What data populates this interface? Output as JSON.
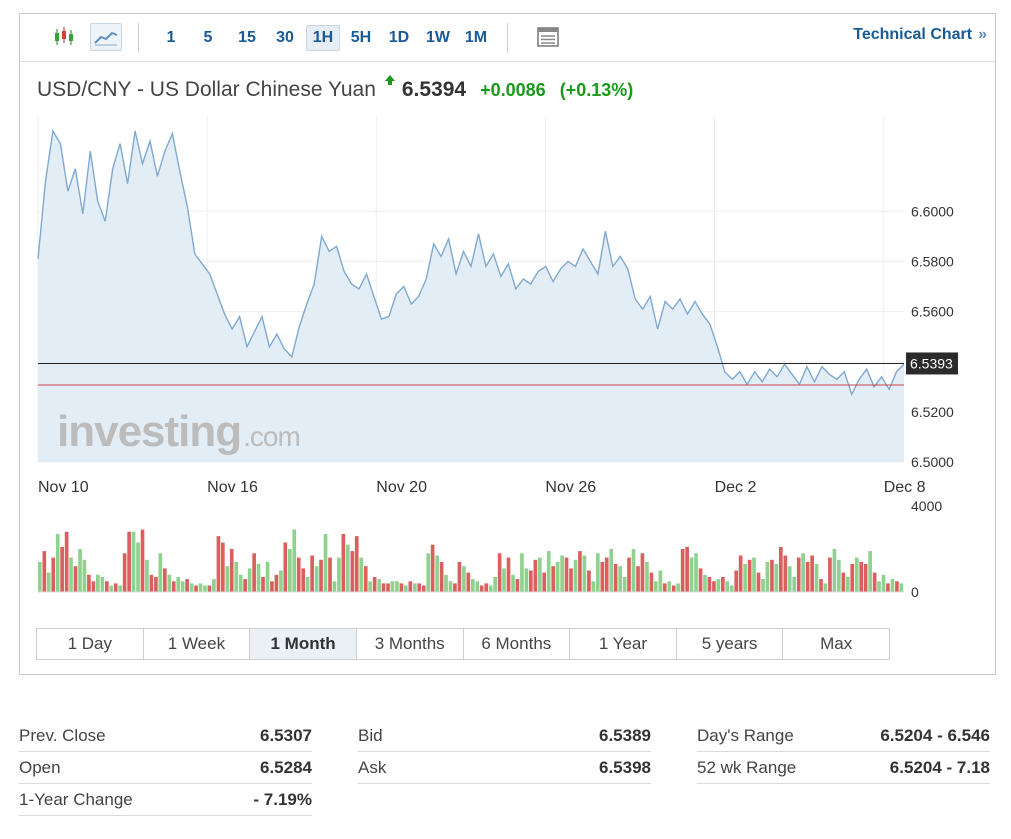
{
  "toolbar": {
    "timeframes": [
      "1",
      "5",
      "15",
      "30",
      "1H",
      "5H",
      "1D",
      "1W",
      "1M"
    ],
    "active_timeframe": "1H",
    "technical_chart_label": "Technical Chart",
    "technical_chart_arrow": "»"
  },
  "instrument": {
    "name": "USD/CNY - US Dollar Chinese Yuan",
    "price": "6.5394",
    "change": "+0.0086",
    "change_pct": "(+0.13%)",
    "up_color": "#1a9a1a"
  },
  "chart_data": {
    "type": "area",
    "x_tick_labels": [
      "Nov 10",
      "Nov 16",
      "Nov 20",
      "Nov 26",
      "Dec 2",
      "Dec 8"
    ],
    "y_tick_labels": [
      "6.6000",
      "6.5800",
      "6.5600",
      "6.5400",
      "6.5200",
      "6.5000"
    ],
    "ylim": [
      6.5,
      6.638
    ],
    "current_price_label": "6.5393",
    "current_price": 6.5393,
    "prev_close_line": 6.5307,
    "watermark": {
      "brand": "investing",
      "suffix": ".com"
    },
    "line_color": "#7fa9d2",
    "fill_color": "#e3edf5",
    "series_price": [
      6.581,
      6.612,
      6.632,
      6.627,
      6.608,
      6.617,
      6.599,
      6.624,
      6.604,
      6.596,
      6.617,
      6.627,
      6.611,
      6.632,
      6.619,
      6.628,
      6.614,
      6.624,
      6.631,
      6.616,
      6.602,
      6.583,
      6.579,
      6.575,
      6.567,
      6.559,
      6.553,
      6.558,
      6.546,
      6.552,
      6.558,
      6.546,
      6.551,
      6.545,
      6.542,
      6.554,
      6.563,
      6.571,
      6.59,
      6.584,
      6.586,
      6.576,
      6.571,
      6.569,
      6.575,
      6.566,
      6.557,
      6.558,
      6.567,
      6.57,
      6.563,
      6.566,
      6.573,
      6.587,
      6.582,
      6.589,
      6.575,
      6.584,
      6.578,
      6.591,
      6.578,
      6.583,
      6.574,
      6.579,
      6.569,
      6.573,
      6.571,
      6.576,
      6.578,
      6.572,
      6.577,
      6.58,
      6.578,
      6.585,
      6.58,
      6.575,
      6.592,
      6.578,
      6.582,
      6.577,
      6.565,
      6.561,
      6.566,
      6.553,
      6.564,
      6.561,
      6.565,
      6.559,
      6.564,
      6.559,
      6.555,
      6.546,
      6.536,
      6.533,
      6.536,
      6.531,
      6.536,
      6.532,
      6.537,
      6.534,
      6.539,
      6.535,
      6.531,
      6.538,
      6.532,
      6.538,
      6.535,
      6.533,
      6.536,
      6.527,
      6.533,
      6.537,
      6.53,
      6.534,
      6.529,
      6.536,
      6.539
    ],
    "volume_max_label": "4000",
    "volume_min_label": "0",
    "volume_max": 4000,
    "volume_up_color": "#8fd18f",
    "volume_down_color": "#d9605f",
    "volumes": [
      1400,
      1900,
      900,
      1600,
      2700,
      2100,
      2800,
      1600,
      1200,
      2000,
      1500,
      800,
      500,
      800,
      700,
      500,
      300,
      400,
      300,
      1800,
      2800,
      2800,
      2300,
      2900,
      1500,
      800,
      700,
      1800,
      1100,
      800,
      500,
      700,
      500,
      600,
      400,
      300,
      400,
      300,
      300,
      600,
      2600,
      2300,
      1200,
      2000,
      1400,
      800,
      600,
      1100,
      1800,
      1300,
      700,
      1400,
      500,
      800,
      1000,
      2300,
      2000,
      2900,
      1600,
      1100,
      700,
      1700,
      1200,
      1500,
      2700,
      1600,
      500,
      1600,
      2700,
      2200,
      1900,
      2600,
      1600,
      1200,
      500,
      700,
      600,
      400,
      400,
      500,
      500,
      400,
      300,
      500,
      400,
      400,
      300,
      1800,
      2200,
      1700,
      1400,
      800,
      500,
      400,
      1400,
      1200,
      900,
      600,
      500,
      300,
      400,
      300,
      700,
      1800,
      1100,
      1600,
      800,
      600,
      1800,
      1100,
      1000,
      1500,
      1600,
      900,
      1900,
      1200,
      1400,
      1700,
      1600,
      1100,
      1500,
      1900,
      1700,
      1000,
      500,
      1800,
      1400,
      1600,
      2000,
      1300,
      1200,
      700,
      1600,
      2000,
      1200,
      1800,
      1400,
      900,
      500,
      1000,
      400,
      500,
      300,
      400,
      2000,
      2100,
      1600,
      1800,
      1100,
      800,
      700,
      500,
      600,
      700,
      500,
      300,
      1000,
      1700,
      1300,
      1500,
      1600,
      900,
      600,
      1400,
      1500,
      1300,
      2100,
      1700,
      1200,
      700,
      1600,
      1800,
      1400,
      1700,
      1300,
      600,
      400,
      1600,
      2000,
      1500,
      900,
      700,
      1300,
      1600,
      1400,
      1300,
      1900,
      900,
      500,
      800,
      400,
      600,
      500,
      400
    ],
    "volume_dirs": [
      1,
      0,
      1,
      0,
      1,
      0,
      0,
      1,
      0,
      1,
      1,
      0,
      0,
      1,
      1,
      0,
      1,
      0,
      1,
      0,
      0,
      1,
      1,
      0,
      1,
      0,
      0,
      1,
      0,
      1,
      0,
      1,
      1,
      0,
      1,
      0,
      1,
      1,
      0,
      1,
      0,
      0,
      1,
      0,
      1,
      1,
      0,
      1,
      0,
      1,
      0,
      1,
      0,
      0,
      1,
      0,
      1,
      1,
      0,
      0,
      1,
      0,
      1,
      0,
      1,
      0,
      1,
      1,
      0,
      1,
      0,
      0,
      1,
      0,
      1,
      0,
      1,
      0,
      0,
      1,
      1,
      0,
      1,
      0,
      1,
      0,
      0,
      1,
      0,
      1,
      0,
      1,
      1,
      0,
      0,
      1,
      0,
      1,
      1,
      0,
      0,
      1,
      1,
      0,
      1,
      0,
      1,
      0,
      1,
      1,
      0,
      0,
      1,
      0,
      1,
      0,
      1,
      1,
      0,
      0,
      1,
      0,
      1,
      0,
      1,
      1,
      0,
      0,
      1,
      0,
      1,
      1,
      0,
      1,
      0,
      0,
      1,
      0,
      1,
      1,
      0,
      1,
      0,
      1,
      0,
      0,
      1,
      1,
      0,
      1,
      0,
      0,
      1,
      0,
      1,
      1,
      0,
      0,
      1,
      0,
      1,
      0,
      1,
      1,
      0,
      1,
      0,
      0,
      1,
      1,
      0,
      1,
      0,
      0,
      1,
      0,
      1,
      0,
      1,
      1,
      0,
      1,
      0,
      1,
      0,
      0,
      1,
      0,
      1,
      1,
      0,
      1,
      0,
      1
    ]
  },
  "range_buttons": [
    "1 Day",
    "1 Week",
    "1 Month",
    "3 Months",
    "6 Months",
    "1 Year",
    "5 years",
    "Max"
  ],
  "active_range": "1 Month",
  "stats": {
    "prev_close": {
      "label": "Prev. Close",
      "value": "6.5307"
    },
    "open": {
      "label": "Open",
      "value": "6.5284"
    },
    "year_change": {
      "label": "1-Year Change",
      "value": "- 7.19%"
    },
    "bid": {
      "label": "Bid",
      "value": "6.5389"
    },
    "ask": {
      "label": "Ask",
      "value": "6.5398"
    },
    "days_range": {
      "label": "Day's Range",
      "value": "6.5204 - 6.546"
    },
    "wk52_range": {
      "label": "52 wk Range",
      "value": "6.5204 - 7.18"
    }
  }
}
